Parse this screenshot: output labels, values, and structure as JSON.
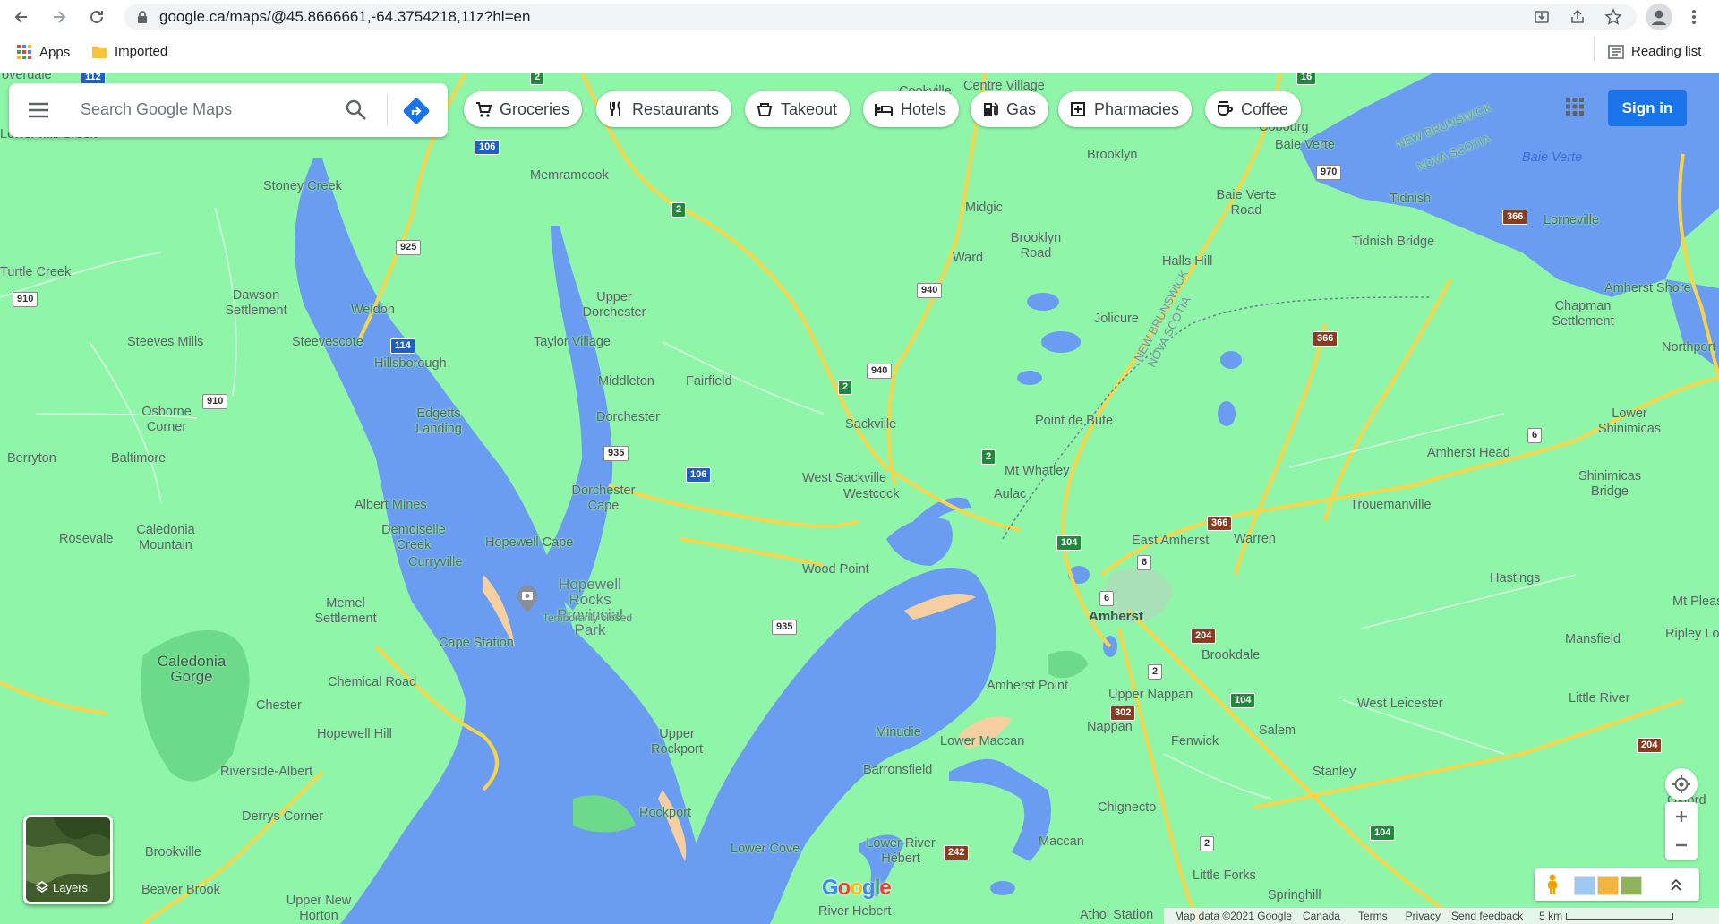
{
  "browser": {
    "url": "google.ca/maps/@45.8666661,-64.3754218,11z?hl=en",
    "bookmarks": [
      "Apps",
      "Imported"
    ],
    "reading_list": "Reading list"
  },
  "search": {
    "placeholder": "Search Google Maps"
  },
  "chips": [
    "Groceries",
    "Restaurants",
    "Takeout",
    "Hotels",
    "Gas",
    "Pharmacies",
    "Coffee"
  ],
  "signin_label": "Sign in",
  "layers_label": "Layers",
  "footer": [
    "Map data ©2021 Google",
    "Canada",
    "Terms",
    "Privacy",
    "Send feedback",
    "5 km"
  ],
  "logo": "Google",
  "places": [
    "overdale",
    "Lower Mill Creek",
    "Stoney Creek",
    "Memramcook",
    "Centre Village",
    "Cookville",
    "Brooklyn",
    "Cobourg",
    "Baie Verte",
    "Turtle Creek",
    "Dawson Settlement",
    "Weldon",
    "Upper Dorchester",
    "Taylor Village",
    "Midgic",
    "Brooklyn Road",
    "Ward",
    "Baie Verte Road",
    "Halls Hill",
    "Tidnish",
    "Tidnish Bridge",
    "Lorneville",
    "Steeves Mills",
    "Steevescote",
    "Hillsborough",
    "Middleton",
    "Fairfield",
    "Jolicure",
    "Amherst Shore",
    "Chapman Settlement",
    "Northport",
    "Osborne Corner",
    "Edgetts Landing",
    "Dorchester",
    "Sackville",
    "Point de Bute",
    "Berryton",
    "Baltimore",
    "West Sackville",
    "Westcock",
    "Mt Whatley",
    "Aulac",
    "Dorchester Cape",
    "Amherst Head",
    "Lower Shinimicas",
    "Shinimicas Bridge",
    "Trouemanville",
    "Albert Mines",
    "Demoiselle Creek",
    "Rosevale",
    "Caledonia Mountain",
    "Hopewell Cape",
    "Curryville",
    "East Amherst",
    "Warren",
    "Hastings",
    "Wood Point",
    "Hopewell Rocks Provincial Park",
    "Temporarily closed",
    "Memel Settlement",
    "Cape Station",
    "Amherst",
    "Brookdale",
    "Mansfield",
    "Caledonia Gorge",
    "Mt Pleasant",
    "Ripley Loop",
    "Chemical Road",
    "Chester",
    "Amherst Point",
    "Upper Nappan",
    "West Leicester",
    "Little River",
    "Hopewell Hill",
    "Upper Rockport",
    "Minudie",
    "Nappan",
    "Lower Maccan",
    "Fenwick",
    "Salem",
    "Riverside-Albert",
    "Barronsfield",
    "Stanley",
    "Derrys Corner",
    "Rockport",
    "Chignecto",
    "Oxford",
    "Lower River Hébert",
    "Maccan",
    "Brookville",
    "Lower Cove",
    "Little Forks",
    "Beaver Brook",
    "Upper New Horton",
    "River Hebert",
    "Springhill",
    "Athol Station"
  ],
  "water_labels": [
    "Baie Verte"
  ],
  "border_labels": [
    "NEW BRUNSWICK",
    "NOVA SCOTIA"
  ],
  "shields": [
    "112",
    "2",
    "16",
    "106",
    "2",
    "925",
    "970",
    "366",
    "910",
    "940",
    "114",
    "940",
    "2",
    "366",
    "910",
    "935",
    "106",
    "2",
    "6",
    "366",
    "104",
    "6",
    "6",
    "935",
    "204",
    "2",
    "302",
    "104",
    "104",
    "204",
    "242",
    "2"
  ]
}
